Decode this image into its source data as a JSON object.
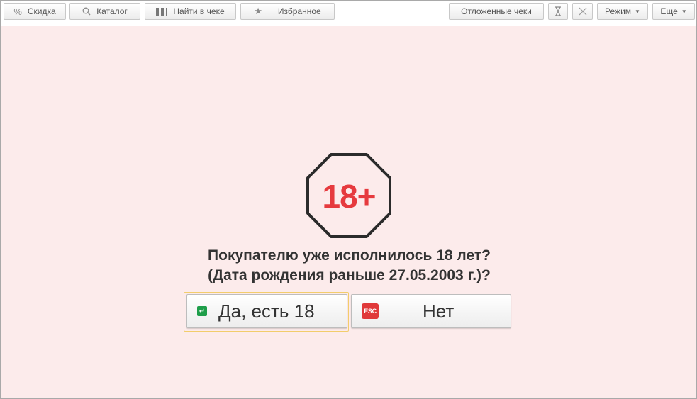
{
  "toolbar": {
    "discount_label": "Скидка",
    "catalog_label": "Каталог",
    "find_in_receipt_label": "Найти в чеке",
    "favorites_label": "Избранное",
    "deferred_receipts_label": "Отложенные чеки",
    "mode_label": "Режим",
    "more_label": "Еще"
  },
  "dialog": {
    "badge_text": "18+",
    "question_line1": "Покупателю уже исполнилось 18 лет?",
    "question_line2": "(Дата рождения раньше 27.05.2003 г.)?",
    "yes_label": "Да, есть 18",
    "no_label": "Нет",
    "yes_key": "↵",
    "no_key": "ESC"
  },
  "colors": {
    "content_bg": "#fcebeb",
    "badge_red": "#e63a3e",
    "badge_border": "#2b2b2b",
    "focus_border": "#f2cd6b"
  },
  "icons": {
    "discount": "percent-icon",
    "catalog": "search-icon",
    "find_in_receipt": "barcode-icon",
    "favorites": "star-icon",
    "hourglass": "hourglass-icon",
    "close": "close-icon"
  }
}
